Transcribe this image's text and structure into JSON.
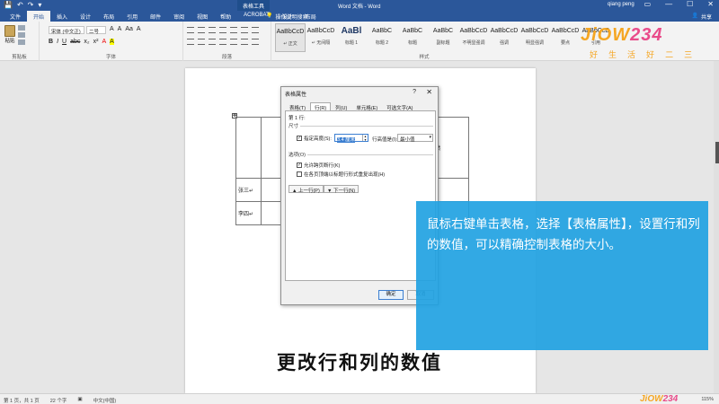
{
  "titlebar": {
    "quick_access": [
      "💾",
      "↶",
      "↷",
      "▾"
    ],
    "context_tool": "表格工具",
    "doc_title": "Word 文档 - Word",
    "user": "qiang peng",
    "window_buttons": [
      "▭",
      "—",
      "☐",
      "✕"
    ]
  },
  "tabs": [
    "文件",
    "开始",
    "插入",
    "设计",
    "布局",
    "引用",
    "邮件",
    "审阅",
    "视图",
    "帮助",
    "ACROBAT",
    "设计",
    "布局"
  ],
  "tellme": "操作说明搜索",
  "share": "共享",
  "ribbon": {
    "paste_label": "粘贴",
    "clipboard_label": "剪贴板",
    "font_name": "宋体 (中文正)",
    "font_size": "二号",
    "format_buttons": [
      "B",
      "I",
      "U",
      "abc",
      "x₂",
      "x²",
      "A",
      "A"
    ],
    "format_buttons2": [
      "A",
      "A",
      "Aa",
      "A"
    ],
    "font_label": "字体",
    "paragraph_label": "段落",
    "styles": [
      {
        "sample": "AaBbCcD",
        "name": "↵ 正文",
        "big": false
      },
      {
        "sample": "AaBbCcD",
        "name": "↵ 无间隔",
        "big": false
      },
      {
        "sample": "AaBl",
        "name": "标题 1",
        "big": true
      },
      {
        "sample": "AaBbC",
        "name": "标题 2",
        "big": false
      },
      {
        "sample": "AaBbC",
        "name": "标题",
        "big": false
      },
      {
        "sample": "AaBbC",
        "name": "副标题",
        "big": false
      },
      {
        "sample": "AaBbCcD",
        "name": "不明显强调",
        "big": false
      },
      {
        "sample": "AaBbCcD",
        "name": "强调",
        "big": false
      },
      {
        "sample": "AaBbCcD",
        "name": "明显强调",
        "big": false
      },
      {
        "sample": "AaBbCcD",
        "name": "要点",
        "big": false
      },
      {
        "sample": "AaBbCcD",
        "name": "引用",
        "big": false
      }
    ],
    "styles_label": "样式"
  },
  "logo": {
    "text_a": "JiOW",
    "text_b": "234",
    "sub": [
      "好",
      "生",
      "活",
      "好",
      "二",
      "三"
    ]
  },
  "document_table": {
    "header_left": "语",
    "header_right": "成绩",
    "rows": [
      {
        "name": "张三↵"
      },
      {
        "name": "李四↵"
      }
    ]
  },
  "dialog": {
    "title": "表格属性",
    "help": "?",
    "close": "✕",
    "tabs": [
      "表格(T)",
      "行(R)",
      "列(U)",
      "单元格(E)",
      "可选文字(A)"
    ],
    "active_tab": 1,
    "row_label": "第 1 行:",
    "size_section": "尺寸",
    "specify_height": "指定高度(S):",
    "height_value": "3.4 厘米",
    "row_height_is": "行高值是(I):",
    "row_height_option": "最小值",
    "options_section": "选项(O)",
    "allow_break": "允许跨页断行(K)",
    "repeat_header": "在各页顶端以标题行形式重复出现(H)",
    "prev_row": "▲ 上一行(P)",
    "next_row": "▼ 下一行(N)",
    "ok": "确定",
    "cancel": "取消"
  },
  "overlay": {
    "text": "鼠标右键单击表格，选择【表格属性】，设置行和列的数值，可以精确控制表格的大小。"
  },
  "subtitle": "更改行和列的数值",
  "statusbar": {
    "page": "第 1 页，共 1 页",
    "words": "22 个字",
    "lang_icon": "▣",
    "language": "中文(中国)",
    "zoom": "115%"
  },
  "colors": {
    "word_blue": "#2b579a",
    "overlay_blue": "#21a2e2",
    "logo_orange": "#f5a623",
    "logo_pink": "#e94b8a"
  }
}
